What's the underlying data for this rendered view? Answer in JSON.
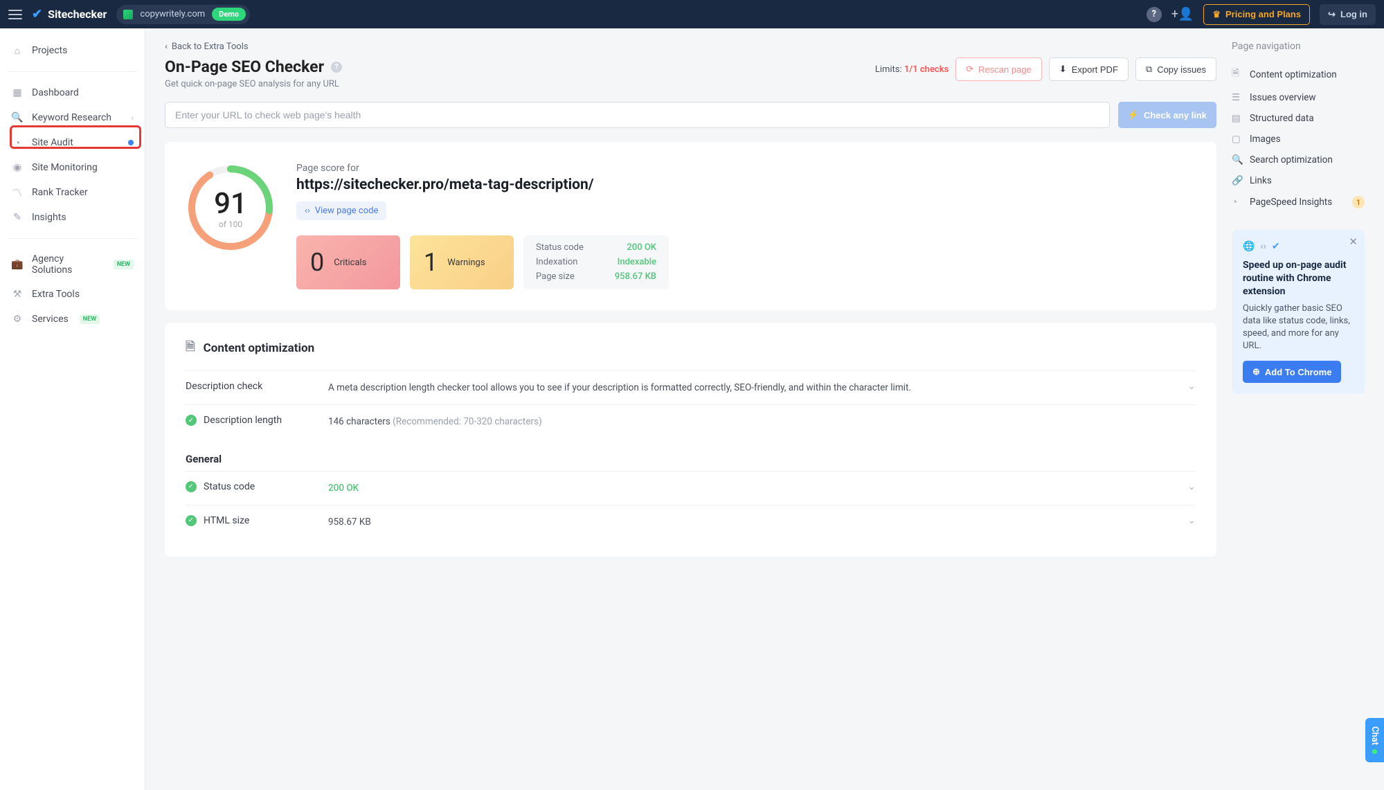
{
  "topbar": {
    "brand": "Sitechecker",
    "site": "copywritely.com",
    "demo": "Demo",
    "pricing": "Pricing and Plans",
    "login": "Log in"
  },
  "sidebar": {
    "projects": "Projects",
    "dashboard": "Dashboard",
    "keyword": "Keyword Research",
    "audit": "Site Audit",
    "monitoring": "Site Monitoring",
    "rank": "Rank Tracker",
    "insights": "Insights",
    "agency": "Agency Solutions",
    "extra": "Extra Tools",
    "services": "Services",
    "new": "NEW"
  },
  "page": {
    "back": "Back to Extra Tools",
    "title": "On-Page SEO Checker",
    "subtitle": "Get quick on-page SEO analysis for any URL",
    "limits_label": "Limits: ",
    "limits_value": "1/1 checks",
    "rescan": "Rescan page",
    "export": "Export PDF",
    "copy": "Copy issues",
    "input_placeholder": "Enter your URL to check web page's health",
    "check_btn": "Check any link"
  },
  "score": {
    "value": "91",
    "of": "of 100",
    "label": "Page score for",
    "url": "https://sitechecker.pro/meta-tag-description/",
    "view_code": "View page code",
    "criticals_n": "0",
    "criticals_l": "Criticals",
    "warnings_n": "1",
    "warnings_l": "Warnings",
    "status_k": "Status code",
    "status_v": "200 OK",
    "index_k": "Indexation",
    "index_v": "Indexable",
    "size_k": "Page size",
    "size_v": "958.67 KB"
  },
  "content": {
    "title": "Content optimization",
    "desc_check": "Description check",
    "desc_text": "A meta description length checker tool allows you to see if your description is formatted correctly, SEO-friendly, and within the character limit.",
    "desc_len_k": "Description length",
    "desc_len_v": "146 characters ",
    "desc_len_rec": "(Recommended: 70-320 characters)",
    "general": "General",
    "status_k": "Status code",
    "status_v": "200 OK",
    "html_k": "HTML size",
    "html_v": "958.67 KB"
  },
  "nav": {
    "title": "Page navigation",
    "items": [
      "Content optimization",
      "Issues overview",
      "Structured data",
      "Images",
      "Search optimization",
      "Links",
      "PageSpeed Insights"
    ],
    "badge": "1"
  },
  "promo": {
    "title": "Speed up on-page audit routine with Chrome extension",
    "body": "Quickly gather basic SEO data like status code, links, speed, and more for any URL.",
    "btn": "Add To Chrome"
  },
  "chat": "Chat"
}
